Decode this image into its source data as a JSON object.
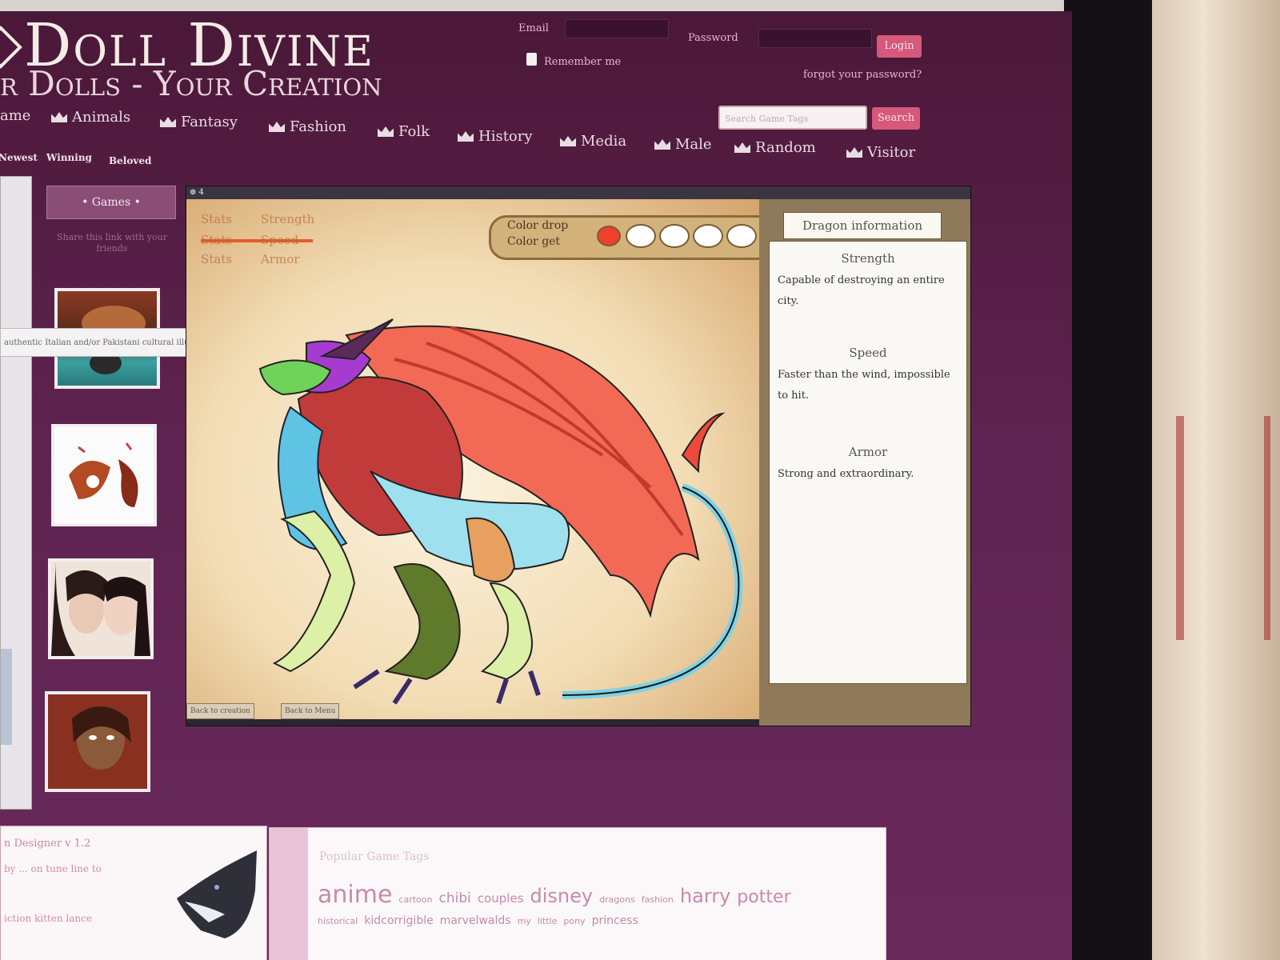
{
  "site": {
    "logo_title": "Doll Divine",
    "logo_subtitle": "r Dolls - Your Creation"
  },
  "login": {
    "email_label": "Email",
    "password_label": "Password",
    "remember_label": "Remember me",
    "login_button": "Login",
    "forgot_link": "forgot your password?"
  },
  "search": {
    "placeholder": "Search Game Tags",
    "button": "Search"
  },
  "nav": {
    "items": [
      "ame",
      "Animals",
      "Fantasy",
      "Fashion",
      "Folk",
      "History",
      "Media",
      "Male",
      "Random",
      "Visitor"
    ]
  },
  "subnav": {
    "items": [
      "Newest",
      "Winning",
      "Beloved"
    ]
  },
  "sidebar": {
    "games_button": "• Games •",
    "intro_text": "Share this link with your friends",
    "tooltip": "authentic Italian and/or Pakistani cultural illustrations"
  },
  "game": {
    "topbar": "⊕ 4",
    "stats": [
      {
        "label": "Stats",
        "value": "Strength"
      },
      {
        "label": "Stats",
        "value": "Speed"
      },
      {
        "label": "Stats",
        "value": "Armor"
      }
    ],
    "color_drop_label": "Color drop",
    "color_get_label": "Color get",
    "info_tab": "Dragon information",
    "info": [
      {
        "heading": "Strength",
        "text": "Capable of destroying an entire city."
      },
      {
        "heading": "Speed",
        "text": "Faster than the wind, impossible to hit."
      },
      {
        "heading": "Armor",
        "text": "Strong and extraordinary."
      }
    ],
    "back_buttons": [
      "Back to creation",
      "Back to Menu"
    ]
  },
  "bottom_left": {
    "title": "n Designer v 1.2",
    "line1": "by ... on tune line to",
    "line2": "iction kitten lance"
  },
  "tags": {
    "title": "Popular Game Tags",
    "row1": [
      {
        "text": "anime",
        "size": 30
      },
      {
        "text": "cartoon",
        "size": 11
      },
      {
        "text": "chibi",
        "size": 17
      },
      {
        "text": "couples",
        "size": 15
      },
      {
        "text": "disney",
        "size": 24
      },
      {
        "text": "dragons",
        "size": 11
      },
      {
        "text": "fashion",
        "size": 11
      },
      {
        "text": "harry",
        "size": 24
      },
      {
        "text": "potter",
        "size": 22
      }
    ],
    "row2": [
      {
        "text": "historical",
        "size": 11
      },
      {
        "text": "kidcorrigible",
        "size": 14
      },
      {
        "text": "marvelwalds",
        "size": 14
      },
      {
        "text": "my",
        "size": 11
      },
      {
        "text": "little",
        "size": 11
      },
      {
        "text": "pony",
        "size": 11
      },
      {
        "text": "princess",
        "size": 14
      }
    ]
  },
  "colors": {
    "bg_purple": "#5e2350",
    "accent_pink": "#d6587b",
    "swatch_red": "#f0402b"
  }
}
